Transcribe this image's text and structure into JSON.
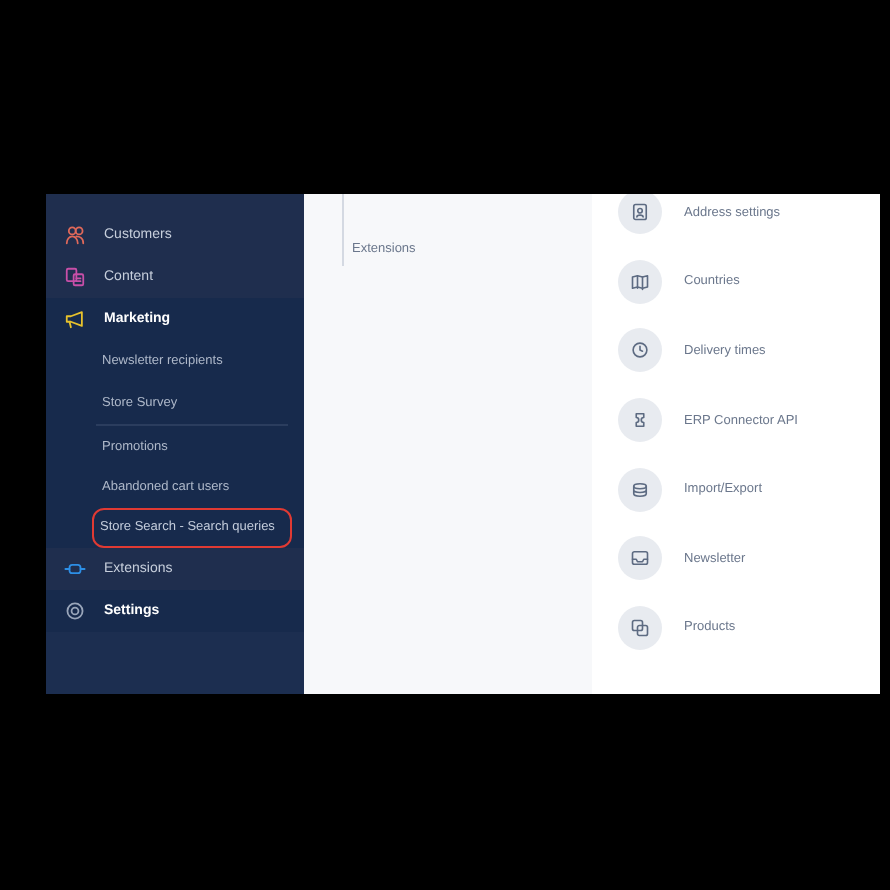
{
  "sidebar": {
    "items": [
      {
        "label": "Customers",
        "kind": "main",
        "selected": false
      },
      {
        "label": "Content",
        "kind": "main",
        "selected": false
      },
      {
        "label": "Marketing",
        "kind": "main",
        "selected": true
      },
      {
        "label": "Newsletter recipients",
        "kind": "sub",
        "selected": false,
        "highlighted": false
      },
      {
        "label": "Store Survey",
        "kind": "sub",
        "selected": false,
        "highlighted": false
      },
      {
        "label": "Promotions",
        "kind": "sub",
        "selected": false,
        "highlighted": false
      },
      {
        "label": "Abandoned cart users",
        "kind": "sub",
        "selected": false,
        "highlighted": false
      },
      {
        "label": "Store Search - Search queries",
        "kind": "sub",
        "selected": false,
        "highlighted": true
      },
      {
        "label": "Extensions",
        "kind": "main",
        "selected": false
      },
      {
        "label": "Settings",
        "kind": "main",
        "selected": true
      }
    ]
  },
  "submenu": {
    "items": [
      "Extensions"
    ]
  },
  "settings": {
    "items": [
      {
        "label": "Address settings"
      },
      {
        "label": "Countries"
      },
      {
        "label": "Delivery times"
      },
      {
        "label": "ERP Connector API"
      },
      {
        "label": "Import/Export"
      },
      {
        "label": "Newsletter"
      },
      {
        "label": "Products"
      }
    ]
  }
}
